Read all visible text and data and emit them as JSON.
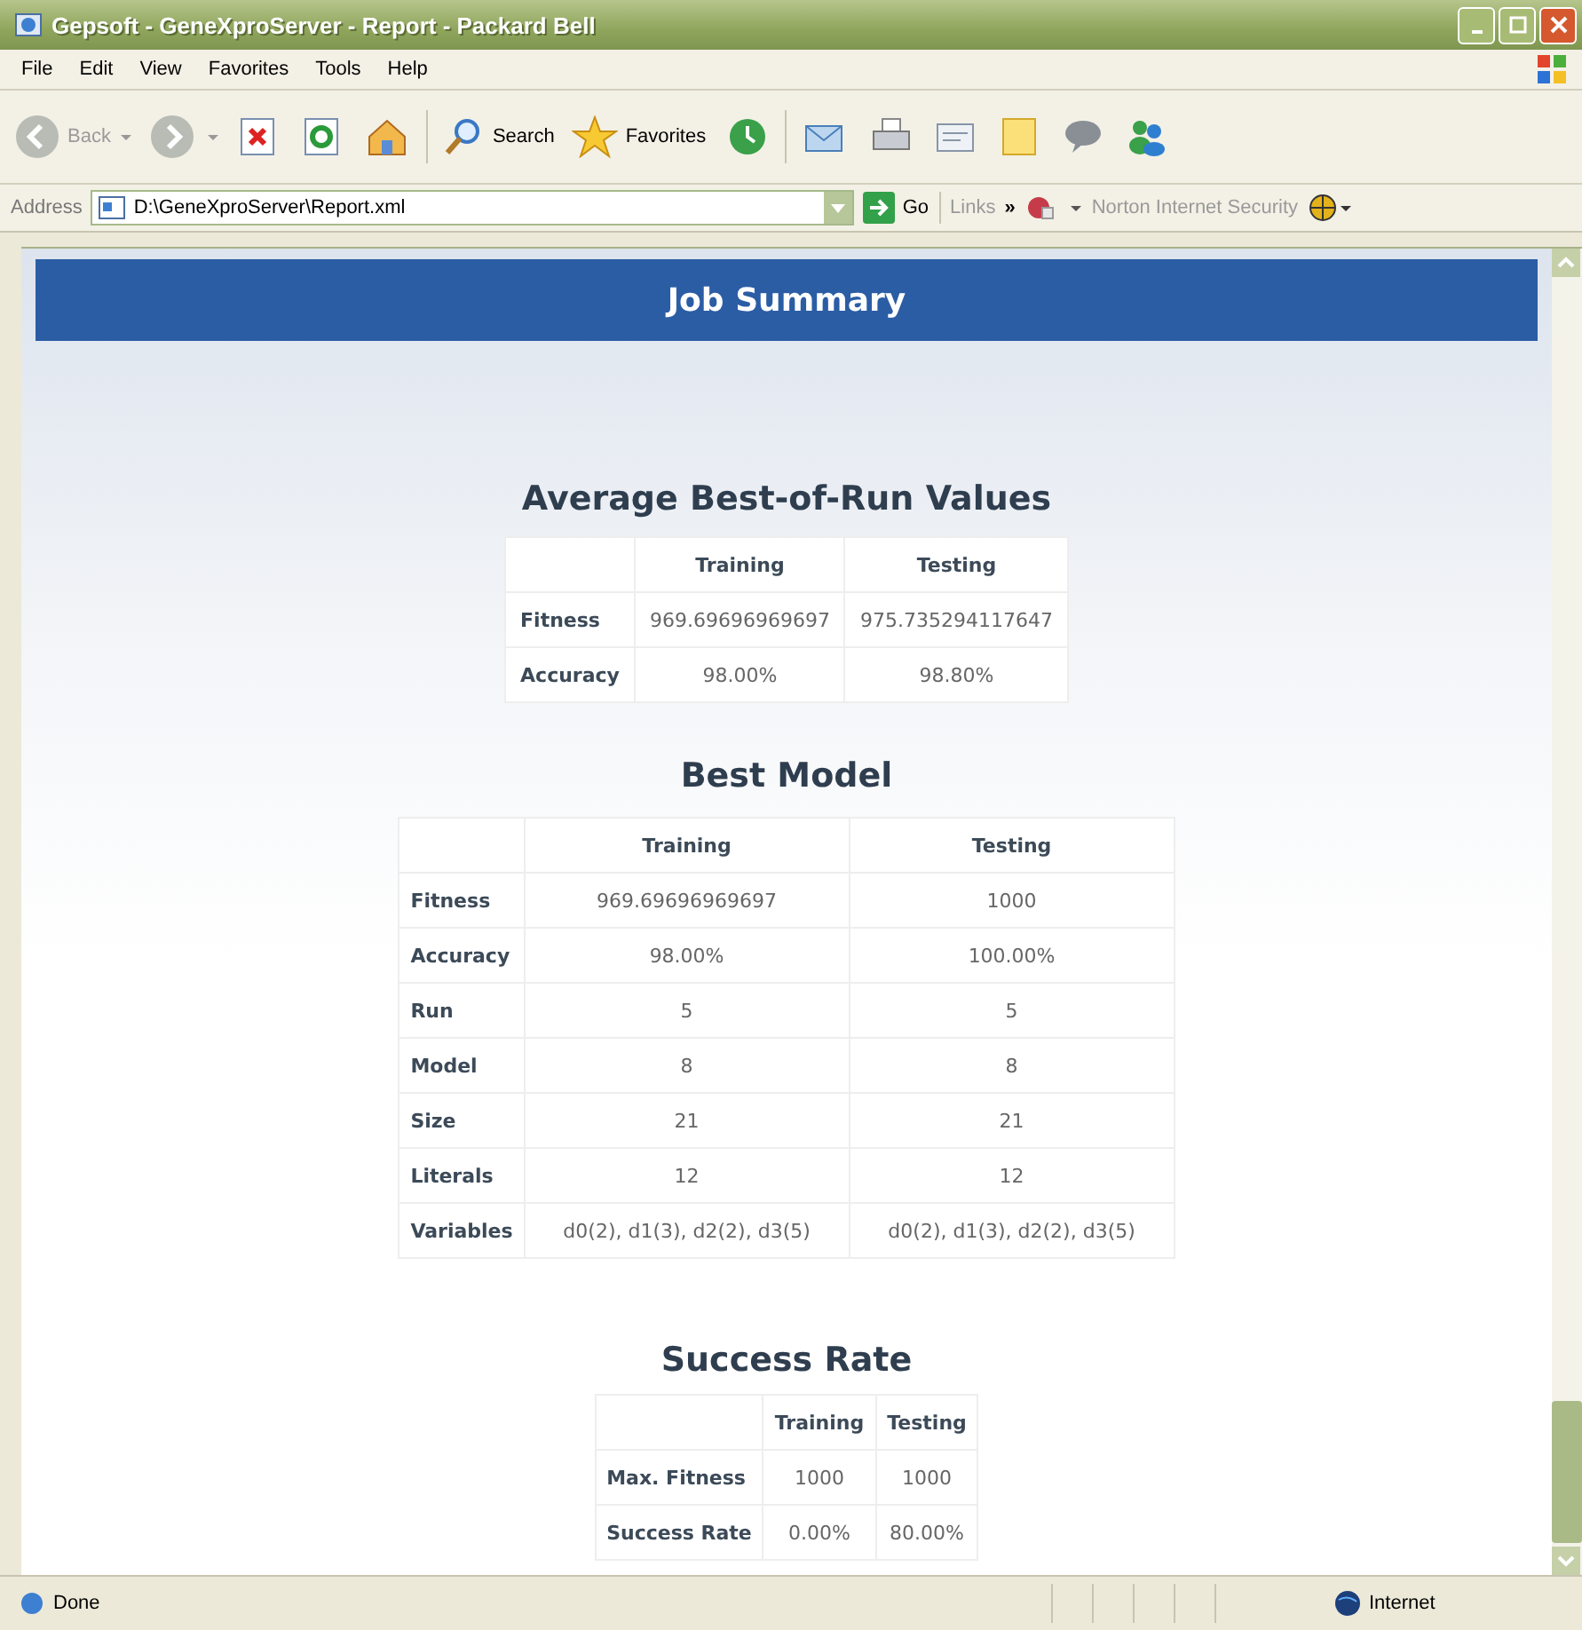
{
  "window": {
    "title": "Gepsoft - GeneXproServer - Report - Packard Bell"
  },
  "menu": [
    "File",
    "Edit",
    "View",
    "Favorites",
    "Tools",
    "Help"
  ],
  "toolbar": {
    "back": {
      "label": "Back",
      "disabled": true
    },
    "search": "Search",
    "favorites": "Favorites"
  },
  "address_bar": {
    "label": "Address",
    "value": "D:\\GeneXproServer\\Report.xml",
    "go": "Go",
    "links": "Links",
    "chevron": "»",
    "norton": "Norton Internet Security"
  },
  "page": {
    "header": "Job Summary",
    "sections": [
      {
        "title": "Average Best-of-Run Values",
        "columns": [
          "Training",
          "Testing"
        ],
        "rows": [
          {
            "label": "Fitness",
            "cells": [
              "969.69696969697",
              "975.735294117647"
            ]
          },
          {
            "label": "Accuracy",
            "cells": [
              "98.00%",
              "98.80%"
            ]
          }
        ]
      },
      {
        "title": "Best Model",
        "columns": [
          "Training",
          "Testing"
        ],
        "rows": [
          {
            "label": "Fitness",
            "cells": [
              "969.69696969697",
              "1000"
            ]
          },
          {
            "label": "Accuracy",
            "cells": [
              "98.00%",
              "100.00%"
            ]
          },
          {
            "label": "Run",
            "cells": [
              "5",
              "5"
            ]
          },
          {
            "label": "Model",
            "cells": [
              "8",
              "8"
            ]
          },
          {
            "label": "Size",
            "cells": [
              "21",
              "21"
            ]
          },
          {
            "label": "Literals",
            "cells": [
              "12",
              "12"
            ]
          },
          {
            "label": "Variables",
            "cells": [
              "d0(2), d1(3), d2(2), d3(5)",
              "d0(2), d1(3), d2(2), d3(5)"
            ]
          }
        ]
      },
      {
        "title": "Success Rate",
        "columns": [
          "Training",
          "Testing"
        ],
        "rows": [
          {
            "label": "Max. Fitness",
            "cells": [
              "1000",
              "1000"
            ]
          },
          {
            "label": "Success Rate",
            "cells": [
              "0.00%",
              "80.00%"
            ]
          }
        ]
      }
    ]
  },
  "status_bar": {
    "text": "Done",
    "zone": "Internet"
  }
}
